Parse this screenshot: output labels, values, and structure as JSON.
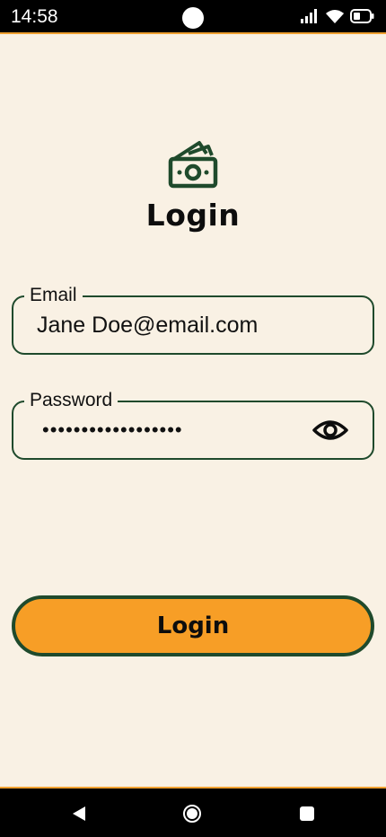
{
  "status_bar": {
    "time": "14:58",
    "icons": [
      "signal-icon",
      "wifi-icon",
      "battery-icon"
    ]
  },
  "header": {
    "brand_icon": "money-icon",
    "title": "Login"
  },
  "form": {
    "email": {
      "label": "Email",
      "value": "Jane Doe@email.com"
    },
    "password": {
      "label": "Password",
      "value": "••••••••••••••••••",
      "toggle_icon": "eye-icon"
    },
    "submit_label": "Login"
  },
  "nav_bar": {
    "icons": [
      "back-icon",
      "home-icon",
      "recents-icon"
    ]
  },
  "colors": {
    "background": "#f9f1e4",
    "accent": "#f79e26",
    "border": "#1f4a2c",
    "system_bar": "#000000"
  }
}
